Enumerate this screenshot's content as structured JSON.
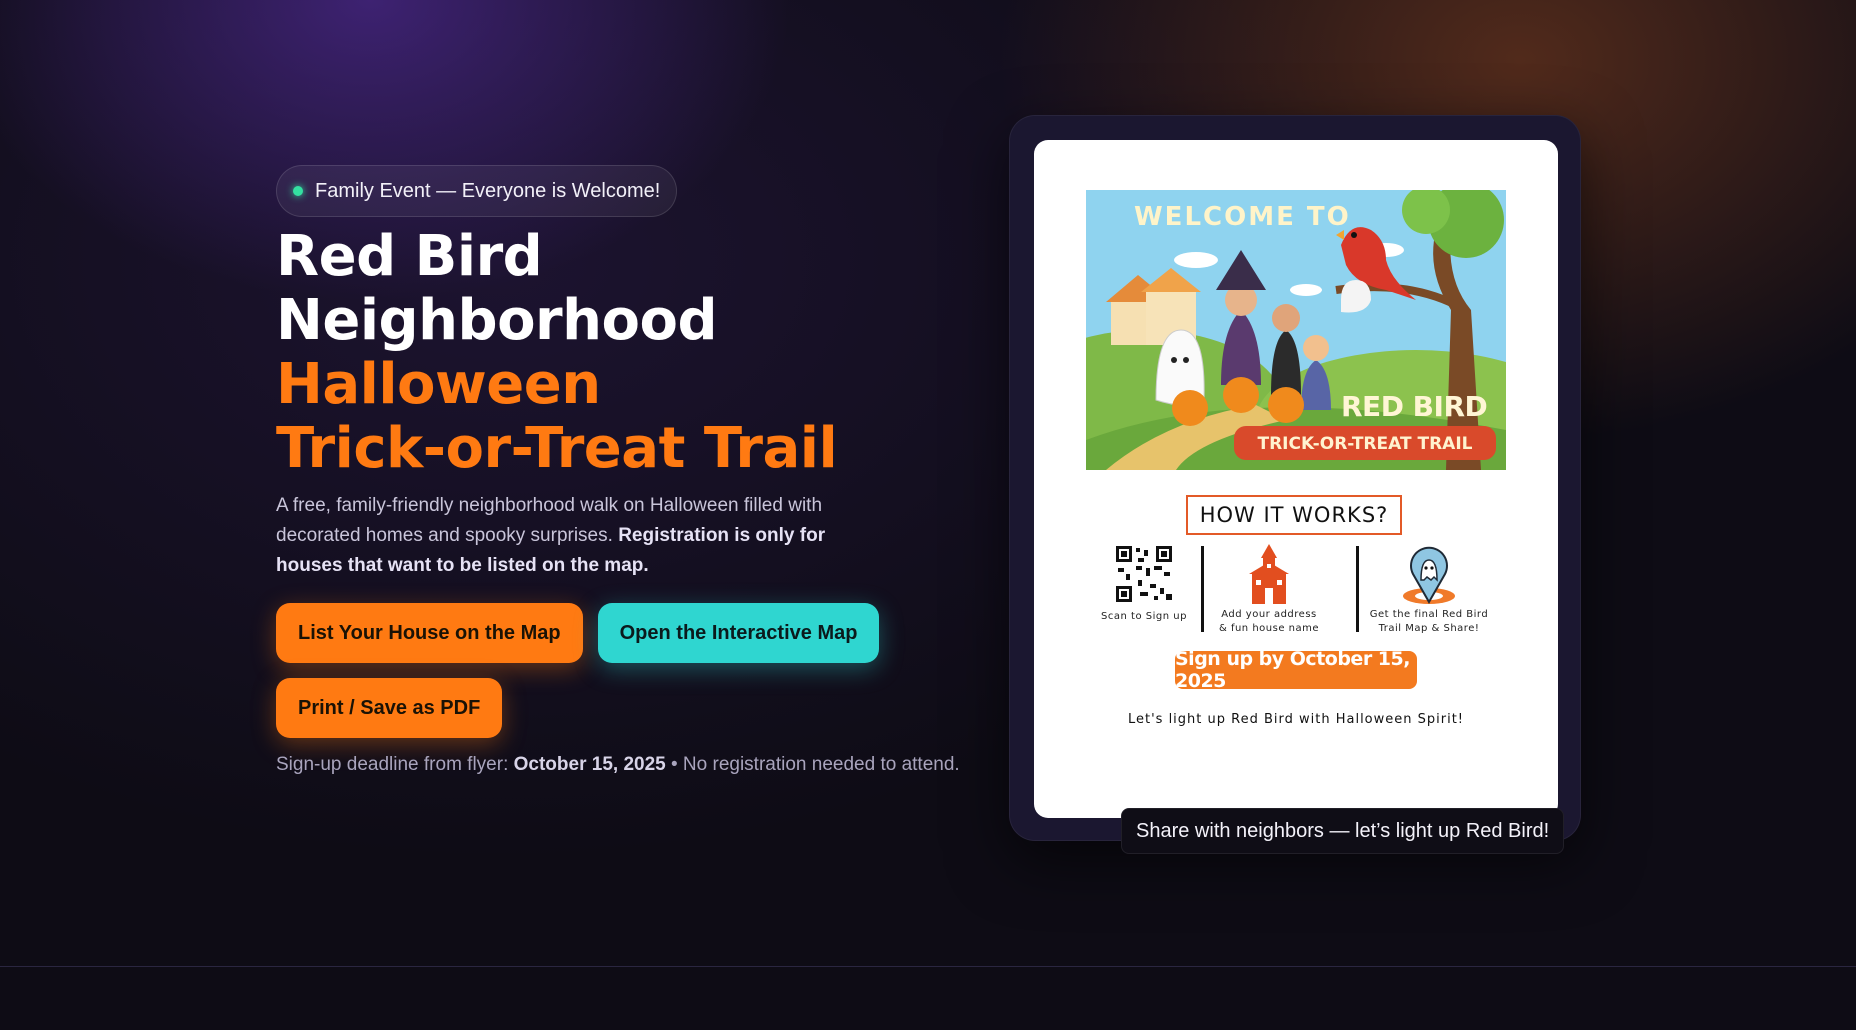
{
  "hero": {
    "pill_text": "Family Event — Everyone is Welcome!",
    "title_line1": "Red Bird",
    "title_line2": "Neighborhood",
    "title_line3": "Halloween",
    "title_line4": "Trick-or-Treat Trail",
    "description_plain": "A free, family-friendly neighborhood walk on Halloween filled with decorated homes and spooky surprises. ",
    "description_bold": "Registration is only for houses that want to be listed on the map.",
    "note_prefix": "Sign-up deadline from flyer: ",
    "note_date": "October 15, 2025",
    "note_suffix": " • No registration needed to attend."
  },
  "buttons": {
    "list_house": "List Your House on the Map",
    "open_map": "Open the Interactive Map",
    "print": "Print / Save as PDF"
  },
  "flyer": {
    "welcome": "WELCOME TO",
    "brand": "RED BIRD",
    "trail": "TRICK-OR-TREAT TRAIL",
    "how_it_works": "HOW IT WORKS?",
    "step1": "Scan to Sign up",
    "step2_line1": "Add your address",
    "step2_line2": "& fun house name",
    "step3_line1": "Get the final Red Bird",
    "step3_line2": "Trail Map & Share!",
    "deadline": "Sign up by October 15, 2025",
    "spirit": "Let's light up Red Bird with Halloween Spirit!"
  },
  "tooltip": "Share with neighbors — let’s light up Red Bird!",
  "colors": {
    "accent_orange": "#ff7a12",
    "accent_teal": "#2fd6d0",
    "status_green": "#34e0a1"
  }
}
